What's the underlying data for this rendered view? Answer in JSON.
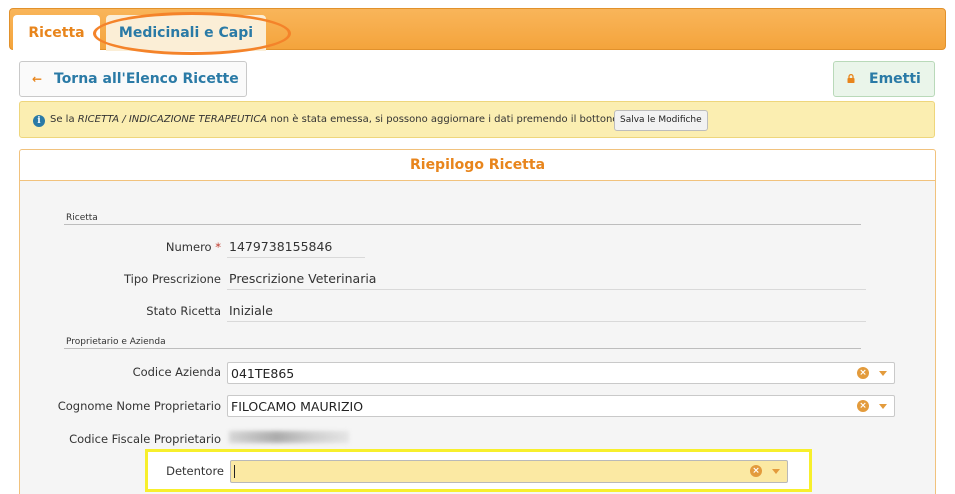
{
  "tabs": [
    {
      "label": "Ricetta",
      "active": true
    },
    {
      "label": "Medicinali e Capi",
      "active": false
    }
  ],
  "toolbar": {
    "back_label": "Torna all'Elenco Ricette",
    "back_icon": "arrow-left-icon",
    "emetti_label": "Emetti",
    "emetti_icon": "lock-icon"
  },
  "info": {
    "icon": "info-icon",
    "text_before": "Se la ",
    "text_emph": "RICETTA / INDICAZIONE TERAPEUTICA",
    "text_after": " non è stata emessa, si possono aggiornare i dati premendo il bottone",
    "button_label": "Salva le Modifiche"
  },
  "panel": {
    "title": "Riepilogo Ricetta",
    "section_ricetta": "Ricetta",
    "section_proprietario": "Proprietario e Azienda",
    "fields": {
      "numero": {
        "label": "Numero",
        "required_mark": "*",
        "value": "1479738155846"
      },
      "tipo_prescrizione": {
        "label": "Tipo Prescrizione",
        "value": "Prescrizione Veterinaria"
      },
      "stato_ricetta": {
        "label": "Stato Ricetta",
        "value": "Iniziale"
      },
      "codice_azienda": {
        "label": "Codice Azienda",
        "value": "041TE865"
      },
      "cognome_nome": {
        "label": "Cognome Nome Proprietario",
        "value": "FILOCAMO MAURIZIO"
      },
      "codice_fiscale": {
        "label": "Codice Fiscale Proprietario",
        "value": ""
      },
      "detentore": {
        "label": "Detentore",
        "value": ""
      }
    }
  },
  "colors": {
    "accent_orange": "#e8851c",
    "link_blue": "#2a7aa6",
    "highlight_yellow": "#f7ef2c",
    "annotation_orange": "#f4832a"
  }
}
